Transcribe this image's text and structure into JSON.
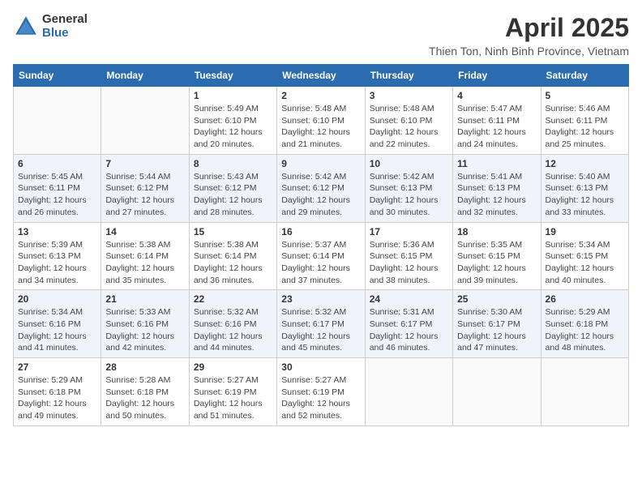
{
  "logo": {
    "general": "General",
    "blue": "Blue"
  },
  "title": "April 2025",
  "location": "Thien Ton, Ninh Binh Province, Vietnam",
  "headers": [
    "Sunday",
    "Monday",
    "Tuesday",
    "Wednesday",
    "Thursday",
    "Friday",
    "Saturday"
  ],
  "weeks": [
    [
      {
        "day": "",
        "info": ""
      },
      {
        "day": "",
        "info": ""
      },
      {
        "day": "1",
        "info": "Sunrise: 5:49 AM\nSunset: 6:10 PM\nDaylight: 12 hours and 20 minutes."
      },
      {
        "day": "2",
        "info": "Sunrise: 5:48 AM\nSunset: 6:10 PM\nDaylight: 12 hours and 21 minutes."
      },
      {
        "day": "3",
        "info": "Sunrise: 5:48 AM\nSunset: 6:10 PM\nDaylight: 12 hours and 22 minutes."
      },
      {
        "day": "4",
        "info": "Sunrise: 5:47 AM\nSunset: 6:11 PM\nDaylight: 12 hours and 24 minutes."
      },
      {
        "day": "5",
        "info": "Sunrise: 5:46 AM\nSunset: 6:11 PM\nDaylight: 12 hours and 25 minutes."
      }
    ],
    [
      {
        "day": "6",
        "info": "Sunrise: 5:45 AM\nSunset: 6:11 PM\nDaylight: 12 hours and 26 minutes."
      },
      {
        "day": "7",
        "info": "Sunrise: 5:44 AM\nSunset: 6:12 PM\nDaylight: 12 hours and 27 minutes."
      },
      {
        "day": "8",
        "info": "Sunrise: 5:43 AM\nSunset: 6:12 PM\nDaylight: 12 hours and 28 minutes."
      },
      {
        "day": "9",
        "info": "Sunrise: 5:42 AM\nSunset: 6:12 PM\nDaylight: 12 hours and 29 minutes."
      },
      {
        "day": "10",
        "info": "Sunrise: 5:42 AM\nSunset: 6:13 PM\nDaylight: 12 hours and 30 minutes."
      },
      {
        "day": "11",
        "info": "Sunrise: 5:41 AM\nSunset: 6:13 PM\nDaylight: 12 hours and 32 minutes."
      },
      {
        "day": "12",
        "info": "Sunrise: 5:40 AM\nSunset: 6:13 PM\nDaylight: 12 hours and 33 minutes."
      }
    ],
    [
      {
        "day": "13",
        "info": "Sunrise: 5:39 AM\nSunset: 6:13 PM\nDaylight: 12 hours and 34 minutes."
      },
      {
        "day": "14",
        "info": "Sunrise: 5:38 AM\nSunset: 6:14 PM\nDaylight: 12 hours and 35 minutes."
      },
      {
        "day": "15",
        "info": "Sunrise: 5:38 AM\nSunset: 6:14 PM\nDaylight: 12 hours and 36 minutes."
      },
      {
        "day": "16",
        "info": "Sunrise: 5:37 AM\nSunset: 6:14 PM\nDaylight: 12 hours and 37 minutes."
      },
      {
        "day": "17",
        "info": "Sunrise: 5:36 AM\nSunset: 6:15 PM\nDaylight: 12 hours and 38 minutes."
      },
      {
        "day": "18",
        "info": "Sunrise: 5:35 AM\nSunset: 6:15 PM\nDaylight: 12 hours and 39 minutes."
      },
      {
        "day": "19",
        "info": "Sunrise: 5:34 AM\nSunset: 6:15 PM\nDaylight: 12 hours and 40 minutes."
      }
    ],
    [
      {
        "day": "20",
        "info": "Sunrise: 5:34 AM\nSunset: 6:16 PM\nDaylight: 12 hours and 41 minutes."
      },
      {
        "day": "21",
        "info": "Sunrise: 5:33 AM\nSunset: 6:16 PM\nDaylight: 12 hours and 42 minutes."
      },
      {
        "day": "22",
        "info": "Sunrise: 5:32 AM\nSunset: 6:16 PM\nDaylight: 12 hours and 44 minutes."
      },
      {
        "day": "23",
        "info": "Sunrise: 5:32 AM\nSunset: 6:17 PM\nDaylight: 12 hours and 45 minutes."
      },
      {
        "day": "24",
        "info": "Sunrise: 5:31 AM\nSunset: 6:17 PM\nDaylight: 12 hours and 46 minutes."
      },
      {
        "day": "25",
        "info": "Sunrise: 5:30 AM\nSunset: 6:17 PM\nDaylight: 12 hours and 47 minutes."
      },
      {
        "day": "26",
        "info": "Sunrise: 5:29 AM\nSunset: 6:18 PM\nDaylight: 12 hours and 48 minutes."
      }
    ],
    [
      {
        "day": "27",
        "info": "Sunrise: 5:29 AM\nSunset: 6:18 PM\nDaylight: 12 hours and 49 minutes."
      },
      {
        "day": "28",
        "info": "Sunrise: 5:28 AM\nSunset: 6:18 PM\nDaylight: 12 hours and 50 minutes."
      },
      {
        "day": "29",
        "info": "Sunrise: 5:27 AM\nSunset: 6:19 PM\nDaylight: 12 hours and 51 minutes."
      },
      {
        "day": "30",
        "info": "Sunrise: 5:27 AM\nSunset: 6:19 PM\nDaylight: 12 hours and 52 minutes."
      },
      {
        "day": "",
        "info": ""
      },
      {
        "day": "",
        "info": ""
      },
      {
        "day": "",
        "info": ""
      }
    ]
  ]
}
